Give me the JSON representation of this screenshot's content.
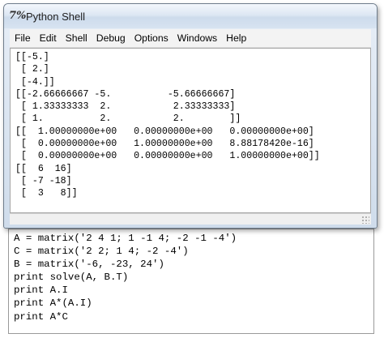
{
  "window": {
    "title": "Python Shell",
    "icon": "python-idle-icon"
  },
  "menu": [
    {
      "label": "File",
      "name": "menu-file"
    },
    {
      "label": "Edit",
      "name": "menu-edit"
    },
    {
      "label": "Shell",
      "name": "menu-shell"
    },
    {
      "label": "Debug",
      "name": "menu-debug"
    },
    {
      "label": "Options",
      "name": "menu-options"
    },
    {
      "label": "Windows",
      "name": "menu-windows"
    },
    {
      "label": "Help",
      "name": "menu-help"
    }
  ],
  "shell_output": [
    "[[-5.]",
    " [ 2.]",
    " [-4.]]",
    "[[-2.66666667 -5.          -5.66666667]",
    " [ 1.33333333  2.           2.33333333]",
    " [ 1.          2.           2.        ]]",
    "[[  1.00000000e+00   0.00000000e+00   0.00000000e+00]",
    " [  0.00000000e+00   1.00000000e+00   8.88178420e-16]",
    " [  0.00000000e+00   0.00000000e+00   1.00000000e+00]]",
    "[[  6  16]",
    " [ -7 -18]",
    " [  3   8]]"
  ],
  "code_lines": [
    "A = matrix('2 4 1; 1 -1 4; -2 -1 -4')",
    "C = matrix('2 2; 1 4; -2 -4')",
    "B = matrix('-6, -23, 24')",
    "print solve(A, B.T)",
    "print A.I",
    "print A*(A.I)",
    "print A*C"
  ]
}
